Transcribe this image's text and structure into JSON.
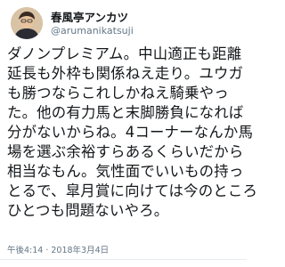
{
  "tweet": {
    "author": {
      "display_name": "春風亭アンカツ",
      "handle": "@arumanikatsuji",
      "avatar_icon": "avatar-icon"
    },
    "text_lines": [
      "ダノンプレミアム。中山適正も距離",
      "延長も外枠も関係ねえ走り。ユウガ",
      "も勝つならこれしかねえ騎乗やっ",
      "た。他の有力馬と末脚勝負になれば",
      "分がないからね。4コーナーなんか馬",
      "場を選ぶ余裕すらあるくらいだから",
      "相当なもん。気性面でいいもの持っ",
      "とるで、皐月賞に向けては今のところ",
      "ひとつも問題ないやろ。"
    ],
    "time": "午後4:14",
    "dot": "·",
    "date": "2018年3月4日"
  },
  "colors": {
    "text": "#14171a",
    "secondary": "#657786",
    "divider": "#e6ecf0"
  }
}
